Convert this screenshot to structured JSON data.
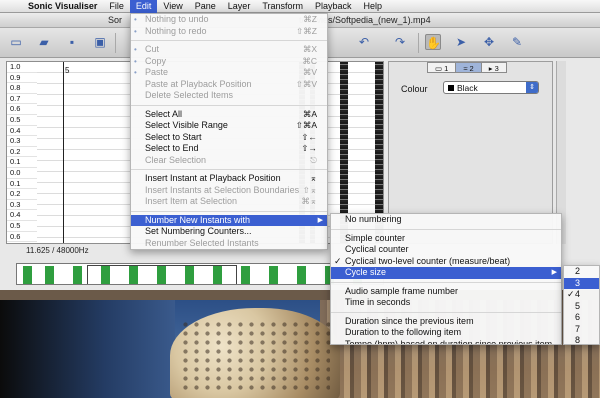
{
  "menubar": {
    "app_name": "Sonic Visualiser",
    "items": [
      "File",
      "Edit",
      "View",
      "Pane",
      "Layer",
      "Transform",
      "Playback",
      "Help"
    ]
  },
  "window": {
    "title_left": "Sor",
    "title": "t/Movies/Softpedia_(new_1).mp4"
  },
  "pane": {
    "scale_values": [
      "1.0",
      "0.9",
      "0.8",
      "0.7",
      "0.6",
      "0.5",
      "0.4",
      "0.3",
      "0.2",
      "0.1",
      "0.0",
      "0.1",
      "0.2",
      "0.3",
      "0.4",
      "0.5",
      "0.6"
    ],
    "cursor_label": "5",
    "sample_rate": "11.625 / 48000Hz"
  },
  "properties": {
    "tabs": [
      "1",
      "2",
      "3"
    ],
    "colour_label": "Colour",
    "colour_value": "Black"
  },
  "edit_menu": {
    "groups": [
      [
        {
          "label": "Nothing to undo",
          "shortcut": "⌘Z",
          "disabled": true,
          "icon": "undo-icon"
        },
        {
          "label": "Nothing to redo",
          "shortcut": "⇧⌘Z",
          "disabled": true,
          "icon": "redo-icon"
        }
      ],
      [
        {
          "label": "Cut",
          "shortcut": "⌘X",
          "disabled": true,
          "icon": "cut-icon"
        },
        {
          "label": "Copy",
          "shortcut": "⌘C",
          "disabled": true,
          "icon": "copy-icon"
        },
        {
          "label": "Paste",
          "shortcut": "⌘V",
          "disabled": true,
          "icon": "paste-icon"
        },
        {
          "label": "Paste at Playback Position",
          "shortcut": "⇧⌘V",
          "disabled": true
        },
        {
          "label": "Delete Selected Items",
          "shortcut": "",
          "disabled": true
        }
      ],
      [
        {
          "label": "Select All",
          "shortcut": "⌘A",
          "disabled": false
        },
        {
          "label": "Select Visible Range",
          "shortcut": "⇧⌘A",
          "disabled": false
        },
        {
          "label": "Select to Start",
          "shortcut": "⇧←",
          "disabled": false
        },
        {
          "label": "Select to End",
          "shortcut": "⇧→",
          "disabled": false
        },
        {
          "label": "Clear Selection",
          "shortcut": "⎋",
          "disabled": true
        }
      ],
      [
        {
          "label": "Insert Instant at Playback Position",
          "shortcut": "⌅",
          "disabled": false
        },
        {
          "label": "Insert Instants at Selection Boundaries",
          "shortcut": "⇧⌅",
          "disabled": true
        },
        {
          "label": "Insert Item at Selection",
          "shortcut": "⌘⌅",
          "disabled": true
        }
      ],
      [
        {
          "label": "Number New Instants with",
          "shortcut": "",
          "disabled": false,
          "highlighted": true,
          "submenu": true
        },
        {
          "label": "Set Numbering Counters...",
          "shortcut": "",
          "disabled": false
        },
        {
          "label": "Renumber Selected Instants",
          "shortcut": "",
          "disabled": true
        }
      ]
    ]
  },
  "numbering_menu": {
    "groups": [
      [
        {
          "label": "No numbering",
          "checked": false
        }
      ],
      [
        {
          "label": "Simple counter",
          "checked": false
        },
        {
          "label": "Cyclical counter",
          "checked": false
        },
        {
          "label": "Cyclical two-level counter (measure/beat)",
          "checked": true
        },
        {
          "label": "Cycle size",
          "checked": false,
          "highlighted": true,
          "submenu": true
        }
      ],
      [
        {
          "label": "Audio sample frame number",
          "checked": false
        },
        {
          "label": "Time in seconds",
          "checked": false
        }
      ],
      [
        {
          "label": "Duration since the previous item",
          "checked": false
        },
        {
          "label": "Duration to the following item",
          "checked": false
        },
        {
          "label": "Tempo (bpm) based on duration since previous item",
          "checked": false
        }
      ]
    ]
  },
  "cycle_size_menu": {
    "items": [
      {
        "label": "2",
        "checked": false
      },
      {
        "label": "3",
        "checked": false,
        "highlighted": true
      },
      {
        "label": "4",
        "checked": true
      },
      {
        "label": "5",
        "checked": false
      },
      {
        "label": "6",
        "checked": false
      },
      {
        "label": "7",
        "checked": false
      },
      {
        "label": "8",
        "checked": false
      }
    ]
  }
}
